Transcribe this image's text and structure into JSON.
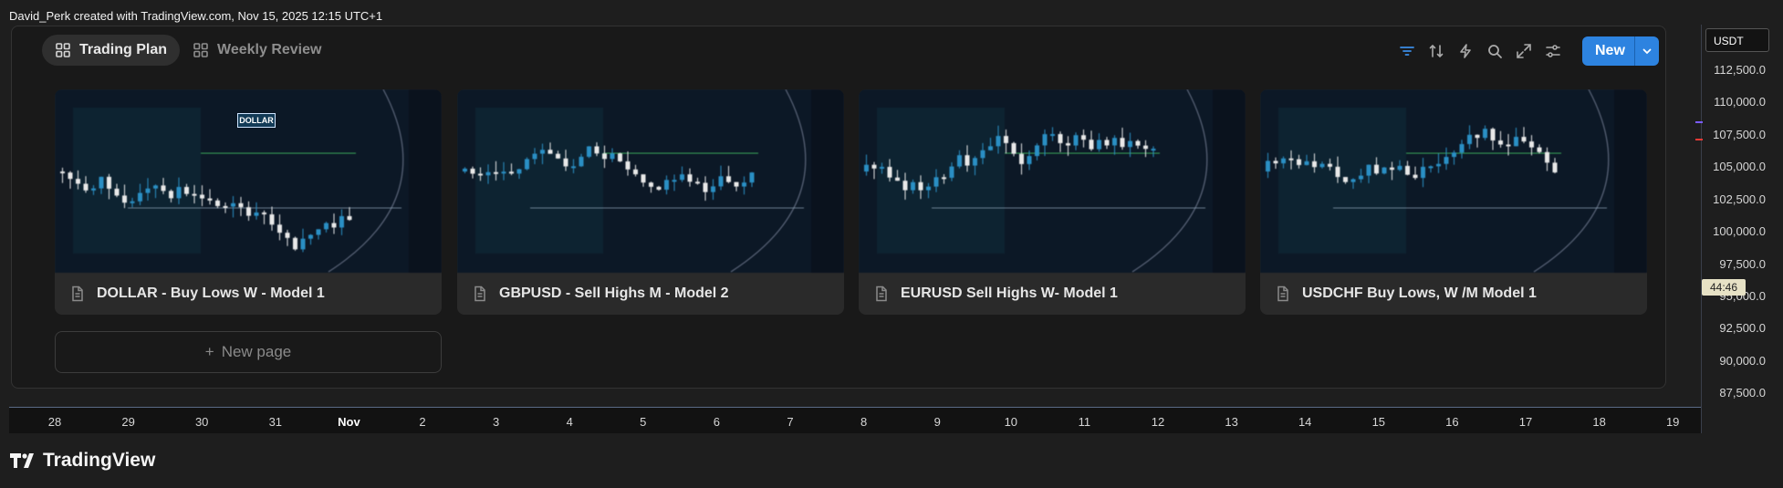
{
  "attribution": "David_Perk created with TradingView.com, Nov 15, 2025 12:15 UTC+1",
  "tabs": [
    {
      "label": "Trading Plan",
      "icon": "grid-icon",
      "active": true
    },
    {
      "label": "Weekly Review",
      "icon": "grid-icon",
      "active": false
    }
  ],
  "toolbar": {
    "icons": [
      "filter-icon",
      "sort-icon",
      "lightning-icon",
      "search-icon",
      "expand-icon",
      "settings-sliders-icon"
    ],
    "new_label": "New"
  },
  "cards": [
    {
      "title": "DOLLAR - Buy Lows W - Model 1",
      "thumb_label": "DOLLAR"
    },
    {
      "title": "GBPUSD - Sell Highs M - Model 2"
    },
    {
      "title": "EURUSD Sell Highs W- Model 1"
    },
    {
      "title": "USDCHF Buy Lows, W /M Model 1"
    }
  ],
  "new_page_label": "New page",
  "price_axis": {
    "currency": "USDT",
    "labels": [
      "112,500.0",
      "110,000.0",
      "107,500.0",
      "105,000.0",
      "102,500.0",
      "100,000.0",
      "97,500.0",
      "95,000.0",
      "92,500.0",
      "90,000.0",
      "87,500.0"
    ],
    "countdown": "44:46"
  },
  "time_axis": {
    "labels": [
      "28",
      "29",
      "30",
      "31",
      "Nov",
      "2",
      "3",
      "4",
      "5",
      "6",
      "7",
      "8",
      "9",
      "10",
      "11",
      "12",
      "13",
      "14",
      "15",
      "16",
      "17",
      "18",
      "19"
    ]
  },
  "logo_text": "TradingView",
  "colors": {
    "accent": "#2d83e0",
    "bull": "#2a8fc4",
    "bear": "#e8e8e8",
    "red": "#e53935"
  }
}
